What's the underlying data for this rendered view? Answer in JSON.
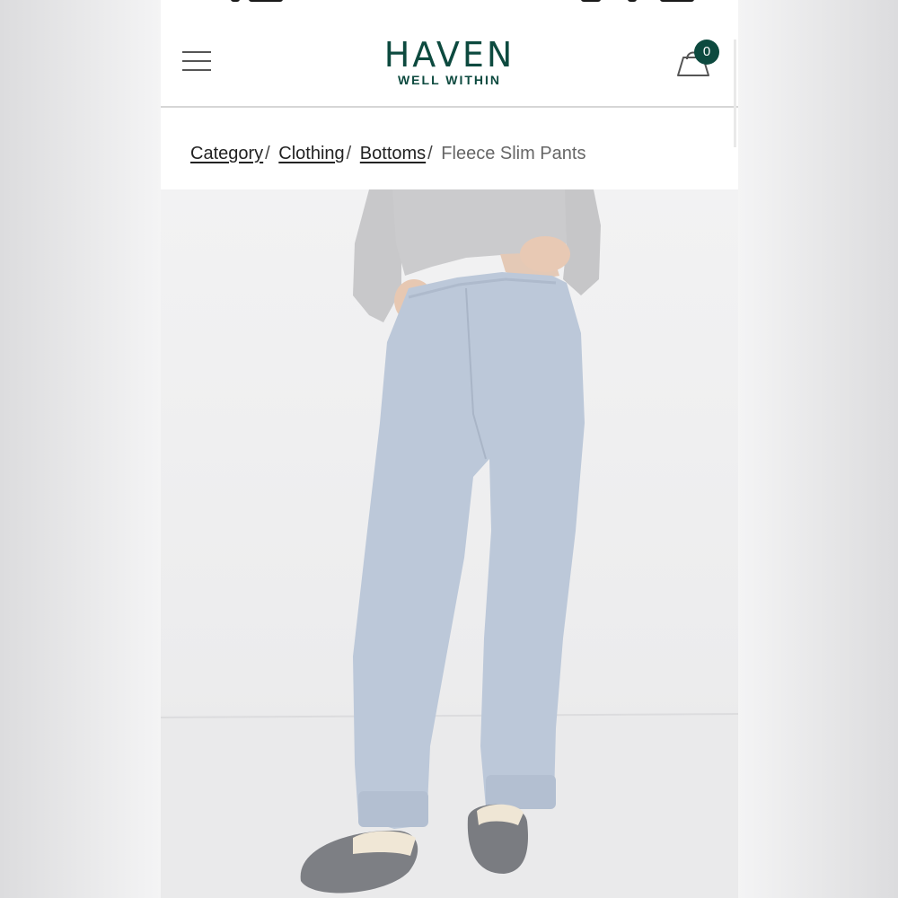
{
  "header": {
    "logo_main": "HAVEN",
    "logo_sub": "WELL WITHIN",
    "cart_count": "0"
  },
  "breadcrumb": {
    "items": [
      "Category",
      "Clothing",
      "Bottoms"
    ],
    "separator": "/",
    "current": "Fleece Slim Pants"
  },
  "product_image": {
    "subject": "model wearing light blue heather fleece slim pants"
  },
  "colors": {
    "brand": "#0d4a3f",
    "pants": "#bcc8d9",
    "top": "#c9c9cb",
    "slippers": "#7d7f84"
  },
  "icons": {
    "menu": "hamburger-menu-icon",
    "cart": "shopping-bag-icon"
  }
}
